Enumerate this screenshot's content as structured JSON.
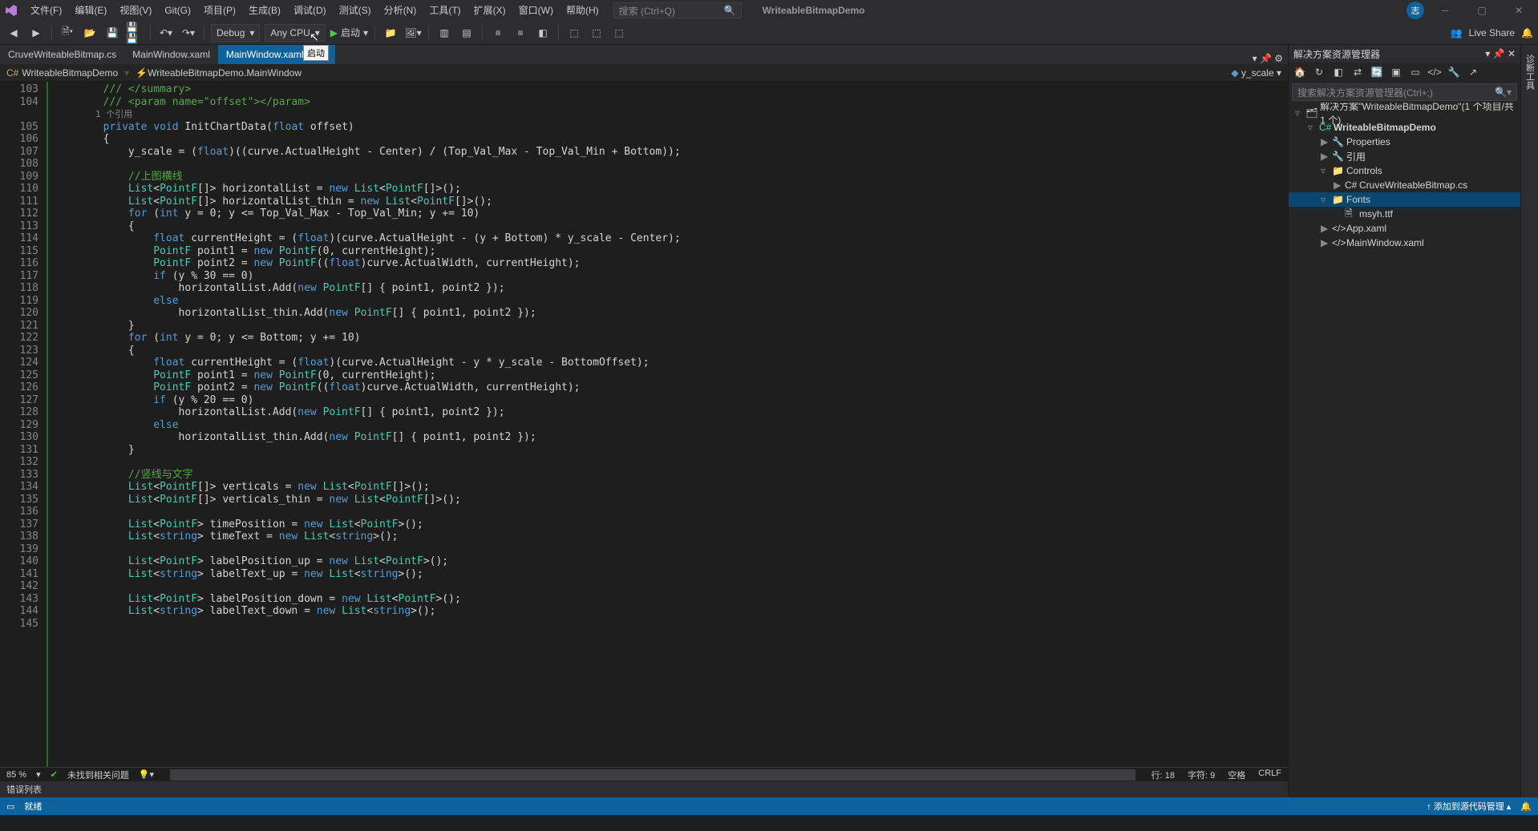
{
  "title": "WriteableBitmapDemo",
  "menu": [
    "文件(F)",
    "编辑(E)",
    "视图(V)",
    "Git(G)",
    "项目(P)",
    "生成(B)",
    "调试(D)",
    "测试(S)",
    "分析(N)",
    "工具(T)",
    "扩展(X)",
    "窗口(W)",
    "帮助(H)"
  ],
  "search_placeholder": "搜索 (Ctrl+Q)",
  "avatar_initial": "志",
  "toolbar": {
    "config": "Debug",
    "platform": "Any CPU",
    "start": "启动",
    "liveshare": "Live Share"
  },
  "tabs": [
    {
      "label": "CruveWriteableBitmap.cs",
      "active": false
    },
    {
      "label": "MainWindow.xaml",
      "active": false
    },
    {
      "label": "MainWindow.xaml.cs",
      "active": true
    }
  ],
  "tooltip": "启动",
  "nav": {
    "scope": "WriteableBitmapDemo",
    "class": "WriteableBitmapDemo.MainWindow",
    "member": "y_scale"
  },
  "lines_start": 103,
  "lines_end": 145,
  "reference_hint": "1 个引用",
  "code_rows": [
    {
      "t": "cmt",
      "s": "        /// </summary>"
    },
    {
      "t": "cmt",
      "s": "        /// <param name=\"offset\"></param>"
    },
    {
      "t": "ref",
      "s": "        1 个引用"
    },
    {
      "t": "mix",
      "s": "        private void InitChartData(float offset)",
      "kw": [
        "private",
        "void",
        "float"
      ]
    },
    {
      "t": "plain",
      "s": "        {"
    },
    {
      "t": "mix",
      "s": "            y_scale = (float)((curve.ActualHeight - Center) / (Top_Val_Max - Top_Val_Min + Bottom));",
      "kw": [
        "float"
      ]
    },
    {
      "t": "plain",
      "s": ""
    },
    {
      "t": "cmt",
      "s": "            //上图横线"
    },
    {
      "t": "mix",
      "s": "            List<PointF[]> horizontalList = new List<PointF[]>();",
      "kw": [
        "new"
      ],
      "typ": [
        "List",
        "PointF"
      ]
    },
    {
      "t": "mix",
      "s": "            List<PointF[]> horizontalList_thin = new List<PointF[]>();",
      "kw": [
        "new"
      ],
      "typ": [
        "List",
        "PointF"
      ]
    },
    {
      "t": "mix",
      "s": "            for (int y = 0; y <= Top_Val_Max - Top_Val_Min; y += 10)",
      "kw": [
        "for",
        "int"
      ]
    },
    {
      "t": "plain",
      "s": "            {"
    },
    {
      "t": "mix",
      "s": "                float currentHeight = (float)(curve.ActualHeight - (y + Bottom) * y_scale - Center);",
      "kw": [
        "float"
      ]
    },
    {
      "t": "mix",
      "s": "                PointF point1 = new PointF(0, currentHeight);",
      "kw": [
        "new"
      ],
      "typ": [
        "PointF"
      ]
    },
    {
      "t": "mix",
      "s": "                PointF point2 = new PointF((float)curve.ActualWidth, currentHeight);",
      "kw": [
        "new",
        "float"
      ],
      "typ": [
        "PointF"
      ]
    },
    {
      "t": "mix",
      "s": "                if (y % 30 == 0)",
      "kw": [
        "if"
      ]
    },
    {
      "t": "mix",
      "s": "                    horizontalList.Add(new PointF[] { point1, point2 });",
      "kw": [
        "new"
      ],
      "typ": [
        "PointF"
      ]
    },
    {
      "t": "mix",
      "s": "                else",
      "kw": [
        "else"
      ]
    },
    {
      "t": "mix",
      "s": "                    horizontalList_thin.Add(new PointF[] { point1, point2 });",
      "kw": [
        "new"
      ],
      "typ": [
        "PointF"
      ]
    },
    {
      "t": "plain",
      "s": "            }"
    },
    {
      "t": "mix",
      "s": "            for (int y = 0; y <= Bottom; y += 10)",
      "kw": [
        "for",
        "int"
      ]
    },
    {
      "t": "plain",
      "s": "            {"
    },
    {
      "t": "mix",
      "s": "                float currentHeight = (float)(curve.ActualHeight - y * y_scale - BottomOffset);",
      "kw": [
        "float"
      ]
    },
    {
      "t": "mix",
      "s": "                PointF point1 = new PointF(0, currentHeight);",
      "kw": [
        "new"
      ],
      "typ": [
        "PointF"
      ]
    },
    {
      "t": "mix",
      "s": "                PointF point2 = new PointF((float)curve.ActualWidth, currentHeight);",
      "kw": [
        "new",
        "float"
      ],
      "typ": [
        "PointF"
      ]
    },
    {
      "t": "mix",
      "s": "                if (y % 20 == 0)",
      "kw": [
        "if"
      ]
    },
    {
      "t": "mix",
      "s": "                    horizontalList.Add(new PointF[] { point1, point2 });",
      "kw": [
        "new"
      ],
      "typ": [
        "PointF"
      ]
    },
    {
      "t": "mix",
      "s": "                else",
      "kw": [
        "else"
      ]
    },
    {
      "t": "mix",
      "s": "                    horizontalList_thin.Add(new PointF[] { point1, point2 });",
      "kw": [
        "new"
      ],
      "typ": [
        "PointF"
      ]
    },
    {
      "t": "plain",
      "s": "            }"
    },
    {
      "t": "plain",
      "s": ""
    },
    {
      "t": "cmt",
      "s": "            //竖线与文字"
    },
    {
      "t": "mix",
      "s": "            List<PointF[]> verticals = new List<PointF[]>();",
      "kw": [
        "new"
      ],
      "typ": [
        "List",
        "PointF"
      ]
    },
    {
      "t": "mix",
      "s": "            List<PointF[]> verticals_thin = new List<PointF[]>();",
      "kw": [
        "new"
      ],
      "typ": [
        "List",
        "PointF"
      ]
    },
    {
      "t": "plain",
      "s": ""
    },
    {
      "t": "mix",
      "s": "            List<PointF> timePosition = new List<PointF>();",
      "kw": [
        "new"
      ],
      "typ": [
        "List",
        "PointF"
      ]
    },
    {
      "t": "mix",
      "s": "            List<string> timeText = new List<string>();",
      "kw": [
        "new",
        "string"
      ],
      "typ": [
        "List"
      ]
    },
    {
      "t": "plain",
      "s": ""
    },
    {
      "t": "mix",
      "s": "            List<PointF> labelPosition_up = new List<PointF>();",
      "kw": [
        "new"
      ],
      "typ": [
        "List",
        "PointF"
      ]
    },
    {
      "t": "mix",
      "s": "            List<string> labelText_up = new List<string>();",
      "kw": [
        "new",
        "string"
      ],
      "typ": [
        "List"
      ]
    },
    {
      "t": "plain",
      "s": ""
    },
    {
      "t": "mix",
      "s": "            List<PointF> labelPosition_down = new List<PointF>();",
      "kw": [
        "new"
      ],
      "typ": [
        "List",
        "PointF"
      ]
    },
    {
      "t": "mix",
      "s": "            List<string> labelText_down = new List<string>();",
      "kw": [
        "new",
        "string"
      ],
      "typ": [
        "List"
      ]
    },
    {
      "t": "plain",
      "s": ""
    }
  ],
  "status1": {
    "zoom": "85 %",
    "issues": "未找到相关问题",
    "line": "行: 18",
    "char": "字符: 9",
    "space": "空格",
    "eol": "CRLF"
  },
  "status_tab": "错误列表",
  "status2": {
    "ready": "就绪",
    "source": "添加到源代码管理"
  },
  "solution": {
    "title": "解决方案资源管理器",
    "search_placeholder": "搜索解决方案资源管理器(Ctrl+;)",
    "root": "解决方案\"WriteableBitmapDemo\"(1 个项目/共 1 个)",
    "project": "WriteableBitmapDemo",
    "nodes": [
      {
        "label": "Properties",
        "indent": 2,
        "arrow": "▶"
      },
      {
        "label": "引用",
        "indent": 2,
        "arrow": "▶"
      },
      {
        "label": "Controls",
        "indent": 2,
        "arrow": "▿",
        "folder": true
      },
      {
        "label": "CruveWriteableBitmap.cs",
        "indent": 3,
        "arrow": "▶"
      },
      {
        "label": "Fonts",
        "indent": 2,
        "arrow": "▿",
        "folder": true,
        "selected": true
      },
      {
        "label": "msyh.ttf",
        "indent": 3,
        "arrow": ""
      },
      {
        "label": "App.xaml",
        "indent": 2,
        "arrow": "▶"
      },
      {
        "label": "MainWindow.xaml",
        "indent": 2,
        "arrow": "▶"
      }
    ]
  }
}
